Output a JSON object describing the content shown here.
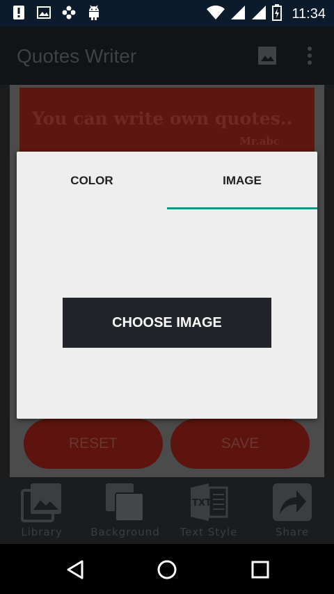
{
  "status_bar": {
    "time": "11:34",
    "left_icons": [
      "alert-icon",
      "gallery-icon",
      "flower-icon",
      "android-icon"
    ],
    "right_icons": [
      "wifi-icon",
      "signal-icon",
      "signal-icon",
      "battery-icon"
    ]
  },
  "app_bar": {
    "title": "Quotes Writer",
    "icons": [
      "image-icon",
      "more-vert-icon"
    ]
  },
  "canvas": {
    "quote": "You can write own quotes..",
    "author": "Mr.abc"
  },
  "actions": {
    "reset_label": "RESET",
    "save_label": "SAVE"
  },
  "bottom_bar": {
    "items": [
      {
        "label": "Library",
        "icon": "library-icon"
      },
      {
        "label": "Background",
        "icon": "background-icon"
      },
      {
        "label": "Text Style",
        "icon": "text-style-icon"
      },
      {
        "label": "Share",
        "icon": "share-icon"
      }
    ]
  },
  "dialog": {
    "tabs": [
      {
        "label": "COLOR",
        "selected": false
      },
      {
        "label": "IMAGE",
        "selected": true
      }
    ],
    "choose_label": "CHOOSE IMAGE"
  },
  "colors": {
    "accent": "#12968a",
    "button_dark": "#21242b",
    "canvas_red": "#5e1710"
  }
}
